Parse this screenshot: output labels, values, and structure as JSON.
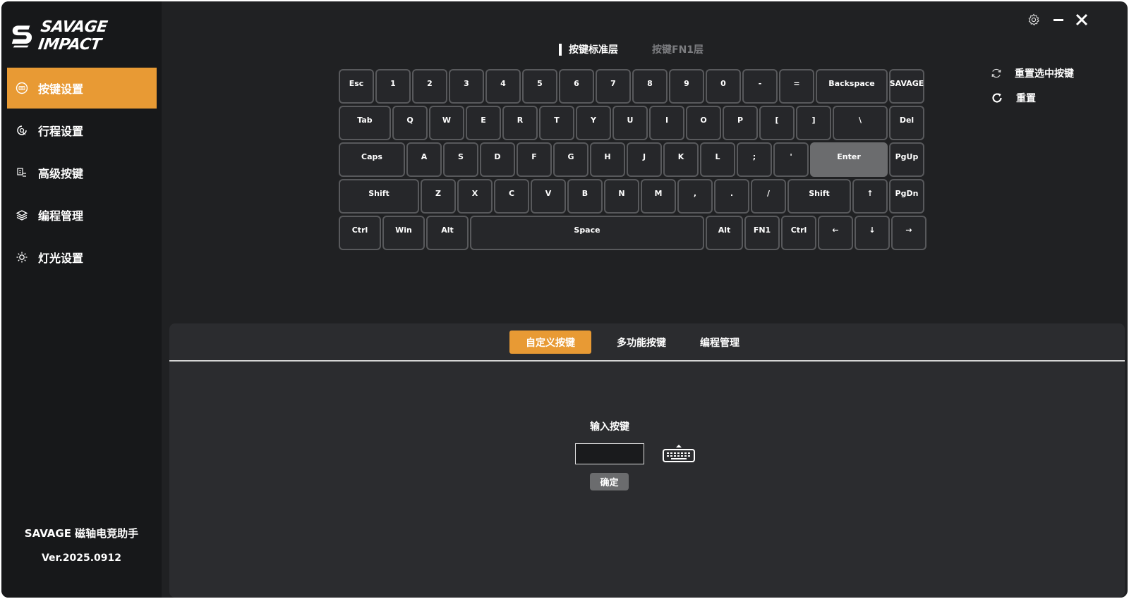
{
  "brand": {
    "logo_text": "SAVAGE IMPACT"
  },
  "sidebar": {
    "items": [
      {
        "label": "按键设置",
        "icon": "keyboard-circle-icon",
        "active": true
      },
      {
        "label": "行程设置",
        "icon": "travel-circle-icon",
        "active": false
      },
      {
        "label": "高级按键",
        "icon": "advanced-key-icon",
        "active": false
      },
      {
        "label": "编程管理",
        "icon": "layers-icon",
        "active": false
      },
      {
        "label": "灯光设置",
        "icon": "sun-icon",
        "active": false
      }
    ],
    "app_name": "SAVAGE 磁轴电竞助手",
    "version": "Ver.2025.0912"
  },
  "layer_tabs": [
    {
      "label": "按键标准层",
      "active": true
    },
    {
      "label": "按键FN1层",
      "active": false
    }
  ],
  "keyboard": {
    "selected_key": "Enter",
    "rows": [
      [
        "Esc",
        "1",
        "2",
        "3",
        "4",
        "5",
        "6",
        "7",
        "8",
        "9",
        "0",
        "-",
        "=",
        "Backspace",
        "SAVAGE"
      ],
      [
        "Tab",
        "Q",
        "W",
        "E",
        "R",
        "T",
        "Y",
        "U",
        "I",
        "O",
        "P",
        "[",
        "]",
        "\\",
        "Del"
      ],
      [
        "Caps",
        "A",
        "S",
        "D",
        "F",
        "G",
        "H",
        "J",
        "K",
        "L",
        ";",
        "'",
        "Enter",
        "PgUp"
      ],
      [
        "Shift",
        "Z",
        "X",
        "C",
        "V",
        "B",
        "N",
        "M",
        ",",
        ".",
        "/",
        "Shift",
        "↑",
        "PgDn"
      ],
      [
        "Ctrl",
        "Win",
        "Alt",
        "Space",
        "Alt",
        "FN1",
        "Ctrl",
        "←",
        "↓",
        "→"
      ]
    ]
  },
  "actions": {
    "reset_selected": "重置选中按键",
    "reset": "重置"
  },
  "panel": {
    "tabs": [
      {
        "label": "自定义按键",
        "active": true
      },
      {
        "label": "多功能按键",
        "active": false
      },
      {
        "label": "编程管理",
        "active": false
      }
    ],
    "input_label": "输入按键",
    "input_value": "",
    "confirm_label": "确定"
  },
  "colors": {
    "accent": "#e89a34",
    "bg": "#202123",
    "sidebar": "#17181a",
    "panel": "#2b2c2f",
    "key_border": "#58595c",
    "key_selected": "#6b6c6e"
  }
}
